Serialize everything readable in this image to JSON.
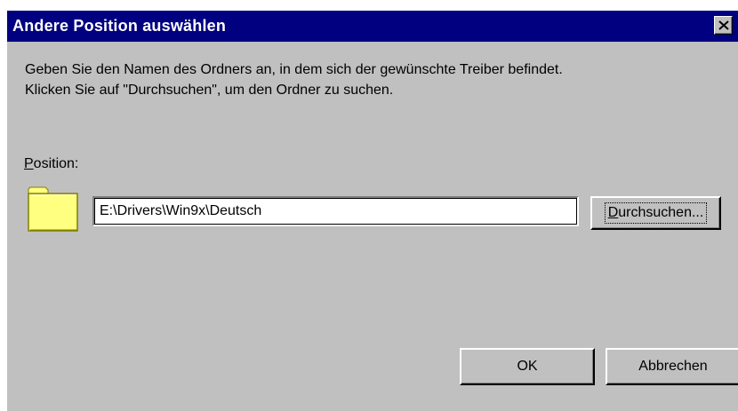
{
  "window": {
    "title": "Andere Position auswählen",
    "close_icon": "close-icon"
  },
  "description": {
    "line1": "Geben Sie den Namen des Ordners an, in dem sich der gewünschte Treiber befindet.",
    "line2": "Klicken Sie auf \"Durchsuchen\", um den Ordner zu suchen."
  },
  "position": {
    "label_accel": "P",
    "label_rest": "osition:",
    "value": "E:\\Drivers\\Win9x\\Deutsch",
    "icon": "folder-icon"
  },
  "buttons": {
    "browse_accel": "D",
    "browse_rest": "urchsuchen...",
    "ok": "OK",
    "cancel": "Abbrechen"
  },
  "colors": {
    "titlebar": "#000080",
    "face": "#c0c0c0",
    "folder": "#ffff80"
  }
}
